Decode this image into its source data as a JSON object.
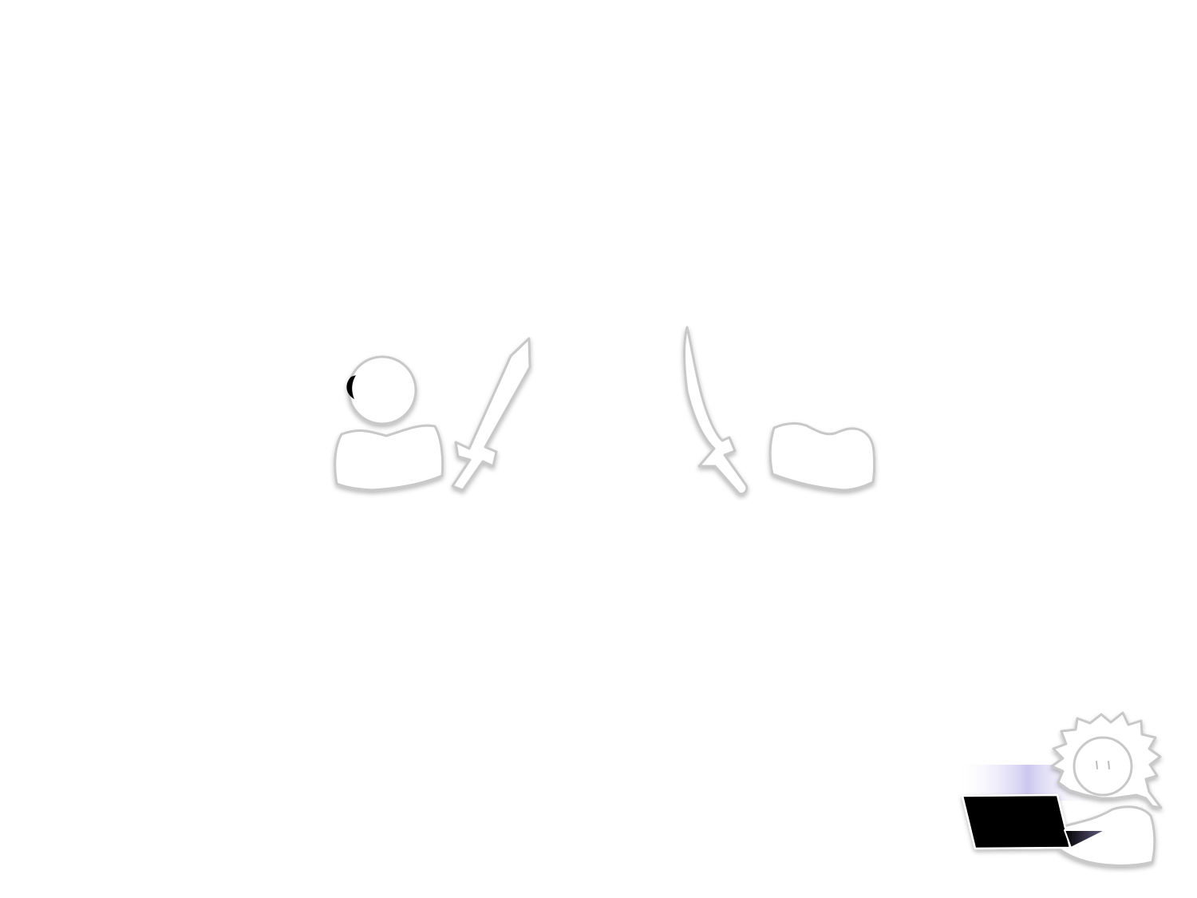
{
  "scene": {
    "background": "#ffffff",
    "outline_color": "#c8c8c8",
    "fill_color": "#ffffff",
    "accent_colors": {
      "eye": "#000000",
      "laptop_screen": "#000000",
      "laptop_glow": "#b9b2ea"
    },
    "figures": [
      {
        "name": "hooded-figure-left",
        "icon": "person-with-sword"
      },
      {
        "name": "headless-figure-right",
        "icon": "person-with-scimitar"
      },
      {
        "name": "narrator-with-laptop",
        "icon": "spiky-hair-person-laptop"
      }
    ]
  }
}
